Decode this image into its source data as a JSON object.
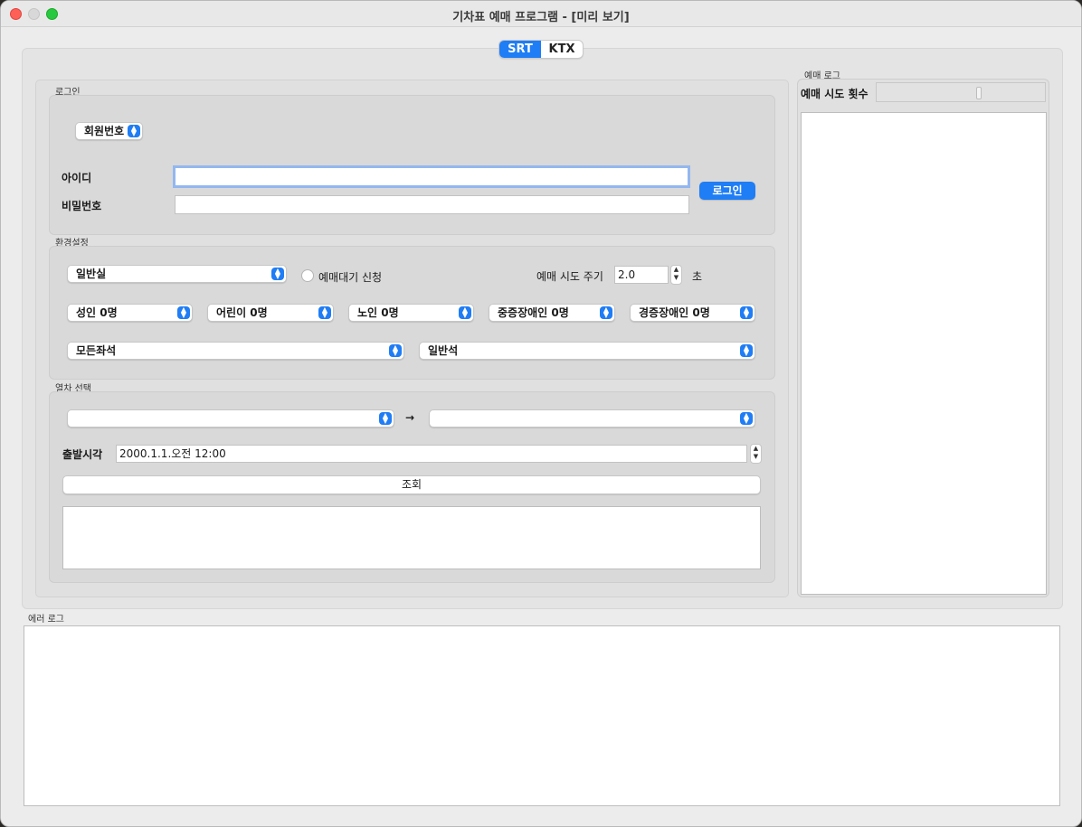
{
  "window": {
    "title": "기차표 예매 프로그램 - [미리 보기]"
  },
  "tabs": [
    {
      "label": "SRT",
      "active": true
    },
    {
      "label": "KTX",
      "active": false
    }
  ],
  "login": {
    "group_label": "로그인",
    "member_type": "회원번호",
    "id_label": "아이디",
    "id_value": "",
    "password_label": "비밀번호",
    "password_value": "",
    "login_button": "로그인"
  },
  "settings": {
    "group_label": "환경설정",
    "seat_class": "일반실",
    "waitlist_label": "예매대기 신청",
    "waitlist_checked": false,
    "interval_label": "예매 시도 주기",
    "interval_value": "2.0",
    "interval_unit": "초",
    "passengers": [
      "성인 0명",
      "어린이 0명",
      "노인 0명",
      "중증장애인 0명",
      "경증장애인 0명"
    ],
    "seat_position": "모든좌석",
    "seat_type": "일반석"
  },
  "train": {
    "group_label": "열차 선택",
    "departure_station": "",
    "arrow": "→",
    "arrival_station": "",
    "depart_time_label": "출발시각",
    "depart_time_value": "2000.1.1.오전 12:00",
    "search_button": "조회",
    "results": ""
  },
  "reservation_log": {
    "group_label": "예매 로그",
    "attempts_label": "예매 시도 횟수"
  },
  "error_log": {
    "group_label": "에러 로그"
  },
  "colors": {
    "accent": "#1f7df5",
    "close": "#fe5f57",
    "maximize": "#28c840"
  }
}
